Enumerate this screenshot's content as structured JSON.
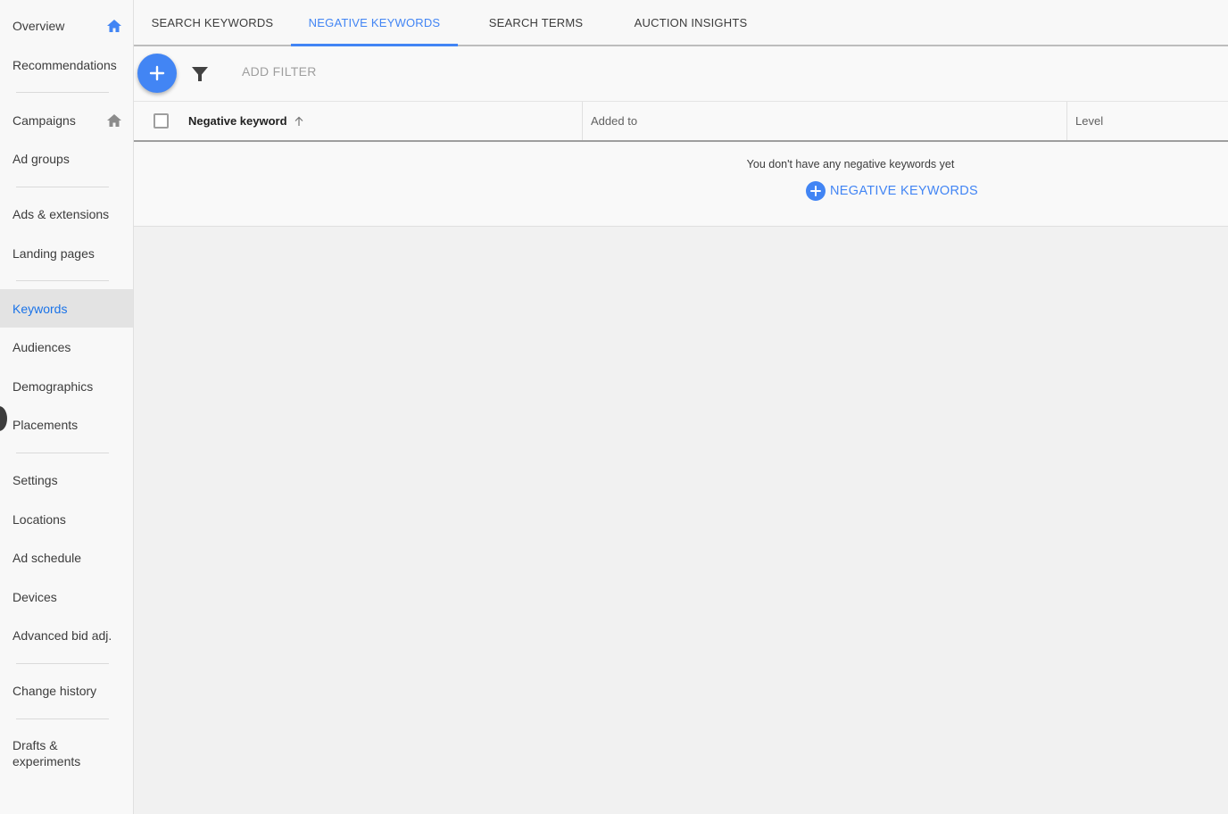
{
  "sidebar": {
    "items": [
      {
        "label": "Overview"
      },
      {
        "label": "Recommendations"
      },
      {
        "label": "Campaigns"
      },
      {
        "label": "Ad groups"
      },
      {
        "label": "Ads & extensions"
      },
      {
        "label": "Landing pages"
      },
      {
        "label": "Keywords"
      },
      {
        "label": "Audiences"
      },
      {
        "label": "Demographics"
      },
      {
        "label": "Placements"
      },
      {
        "label": "Settings"
      },
      {
        "label": "Locations"
      },
      {
        "label": "Ad schedule"
      },
      {
        "label": "Devices"
      },
      {
        "label": "Advanced bid adj."
      },
      {
        "label": "Change history"
      },
      {
        "label": "Drafts &"
      }
    ],
    "drafts_line2": "experiments",
    "active": "Keywords"
  },
  "tabs": [
    {
      "label": "SEARCH KEYWORDS"
    },
    {
      "label": "NEGATIVE KEYWORDS"
    },
    {
      "label": "SEARCH TERMS"
    },
    {
      "label": "AUCTION INSIGHTS"
    }
  ],
  "toolbar": {
    "add_filter": "ADD FILTER",
    "icons": [
      "plus-icon",
      "filter-icon"
    ]
  },
  "table": {
    "columns": [
      {
        "label": "Negative keyword",
        "sorted": "ascending"
      },
      {
        "label": "Added to"
      },
      {
        "label": "Level"
      }
    ]
  },
  "empty_state": {
    "message": "You don't have any negative keywords yet",
    "action_label": "NEGATIVE KEYWORDS"
  },
  "colors": {
    "accent": "#4285f4",
    "active_nav_bg": "#e3e3e3",
    "background": "#f1f1f1"
  }
}
